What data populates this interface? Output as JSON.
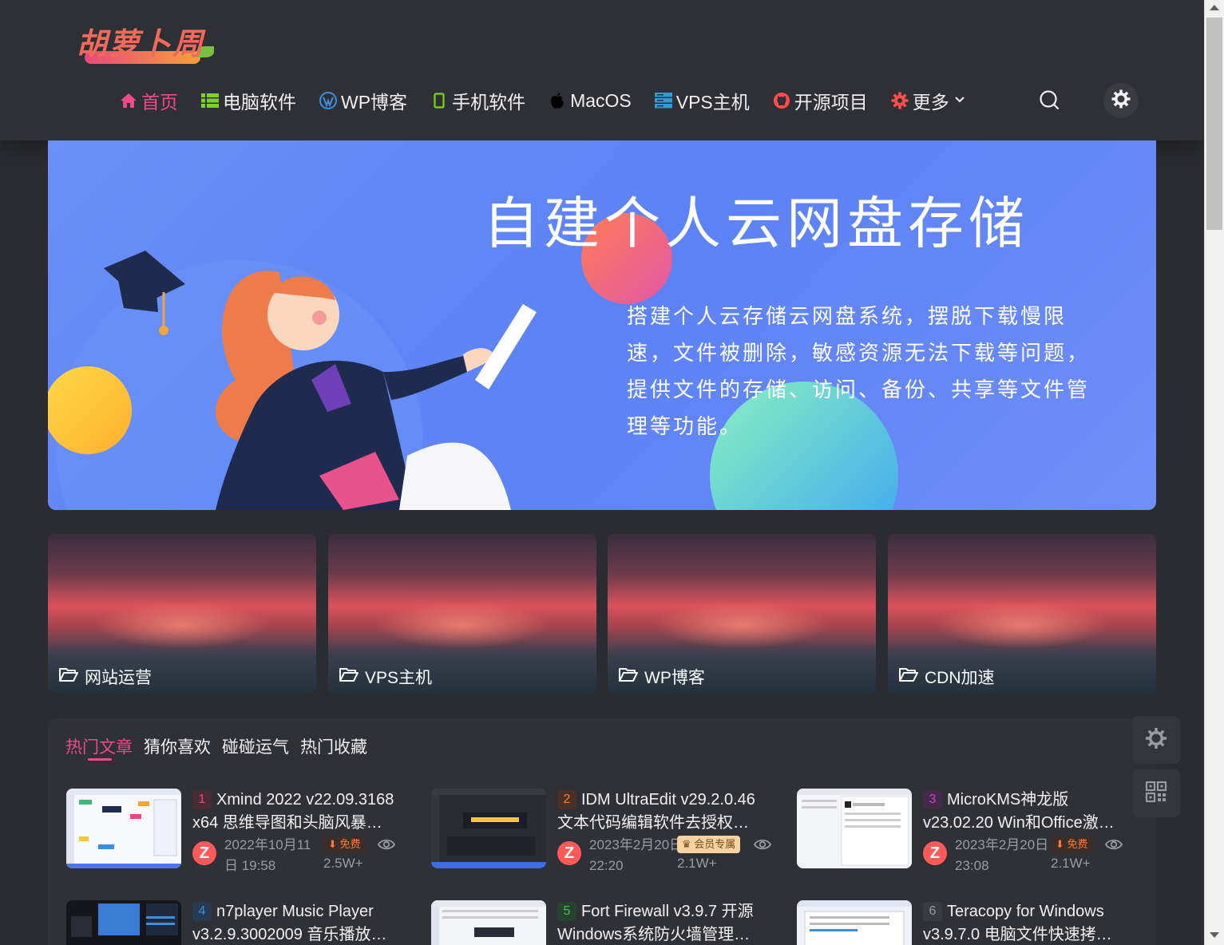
{
  "site": {
    "logo_text": "胡萝卜周"
  },
  "nav": {
    "items": [
      {
        "label": "首页",
        "icon": "home-icon",
        "color": "#ea4c89"
      },
      {
        "label": "电脑软件",
        "icon": "list-icon",
        "color": "#7ed321"
      },
      {
        "label": "WP博客",
        "icon": "wordpress-icon",
        "color": "#3b8ee0"
      },
      {
        "label": "手机软件",
        "icon": "mobile-icon",
        "color": "#7ed321"
      },
      {
        "label": "MacOS",
        "icon": "apple-icon",
        "color": "#000000"
      },
      {
        "label": "VPS主机",
        "icon": "server-icon",
        "color": "#2d9cdb"
      },
      {
        "label": "开源项目",
        "icon": "github-icon",
        "color": "#ff4d4d"
      },
      {
        "label": "更多",
        "icon": "gear-icon",
        "color": "#ff4d4d"
      }
    ]
  },
  "banner": {
    "title": "自建个人云网盘存储",
    "description": "搭建个人云存储云网盘系统，摆脱下载慢限速，文件被删除，敏感资源无法下载等问题，提供文件的存储、访问、备份、共享等文件管理等功能。"
  },
  "categories": [
    {
      "label": "网站运营"
    },
    {
      "label": "VPS主机"
    },
    {
      "label": "WP博客"
    },
    {
      "label": "CDN加速"
    }
  ],
  "tabs": [
    {
      "label": "热门文章"
    },
    {
      "label": "猜你喜欢"
    },
    {
      "label": "碰碰运气"
    },
    {
      "label": "热门收藏"
    }
  ],
  "posts": [
    {
      "rank": "1",
      "title": "Xmind 2022 v22.09.3168 x64 思维导图和头脑风暴…",
      "date": "2022年10月11日 19:58",
      "badge": "免费",
      "badge_type": "free",
      "views": "2.5W+",
      "rank_color": "#e8487b"
    },
    {
      "rank": "2",
      "title": "IDM UltraEdit v29.2.0.46 文本代码编辑软件去授权…",
      "date": "2023年2月20日 22:20",
      "badge": "会员专属",
      "badge_type": "vip",
      "views": "2.1W+",
      "rank_color": "#ff7a2f"
    },
    {
      "rank": "3",
      "title": "MicroKMS神龙版 v23.02.20 Win和Office激…",
      "date": "2023年2月20日 23:08",
      "badge": "免费",
      "badge_type": "free",
      "views": "2.1W+",
      "rank_color": "#d63bd6"
    },
    {
      "rank": "4",
      "title": "n7player Music Player v3.2.9.3002009 音乐播放…",
      "rank_color": "#3b8ee0"
    },
    {
      "rank": "5",
      "title": "Fort Firewall v3.9.7 开源 Windows系统防火墙管理…",
      "rank_color": "#3fbf5a"
    },
    {
      "rank": "6",
      "title": "Teracopy for Windows v3.9.7.0 电脑文件快速拷…",
      "rank_color": "#9a9ba1"
    }
  ],
  "author_avatar_letter": "Z"
}
